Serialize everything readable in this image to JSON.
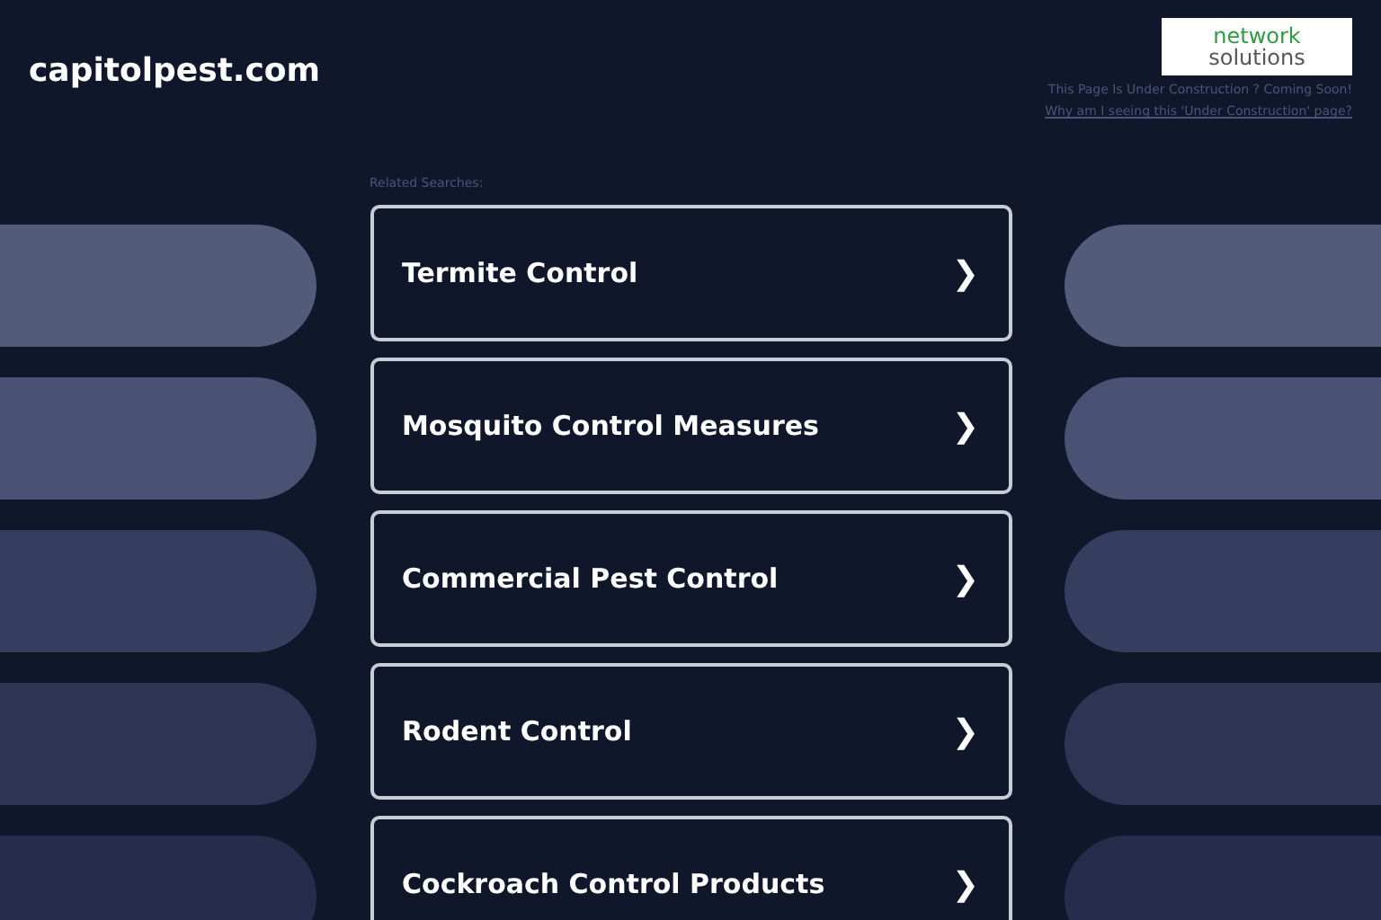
{
  "site": {
    "domain": "capitolpest.com"
  },
  "logo": {
    "line_1": "network",
    "line_2": "solutions"
  },
  "notice": {
    "text": "This Page Is Under Construction ? Coming Soon!",
    "link": "Why am I seeing this 'Under Construction' page?"
  },
  "related": {
    "heading": "Related Searches:",
    "links": [
      {
        "label": "Termite Control",
        "arrow": "❯"
      },
      {
        "label": "Mosquito Control Measures",
        "arrow": "❯"
      },
      {
        "label": "Commercial Pest Control",
        "arrow": "❯"
      },
      {
        "label": "Rodent Control",
        "arrow": "❯"
      },
      {
        "label": "Cockroach Control Products",
        "arrow": "❯"
      }
    ]
  }
}
